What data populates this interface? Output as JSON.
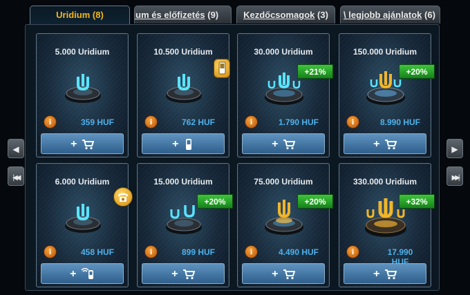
{
  "tabs": [
    {
      "label": "Uridium",
      "count": "(8)",
      "active": true
    },
    {
      "label": "mium és előfizetés",
      "count": "(9)",
      "active": false
    },
    {
      "label": "Kezdőcsomagok",
      "count": "(3)",
      "active": false
    },
    {
      "label": "\\ legjobb ajánlatok",
      "count": "(6)",
      "active": false
    }
  ],
  "nav": {
    "prev_icon": "arrow-left-icon",
    "first_icon": "skip-first-icon",
    "next_icon": "arrow-right-icon",
    "last_icon": "skip-last-icon"
  },
  "colors": {
    "accent_tab": "#f3b81c",
    "price": "#4fb1ec",
    "bonus": "#2ba62e",
    "buy_button": "#3f74a3"
  },
  "cards": [
    {
      "title": "5.000 Uridium",
      "price": "359 HUF",
      "bonus": "",
      "badge": "",
      "buy_icon": "cart-icon"
    },
    {
      "title": "10.500 Uridium",
      "price": "762 HUF",
      "bonus": "",
      "badge": "mobile-icon",
      "buy_icon": "mobile-phone-icon"
    },
    {
      "title": "30.000 Uridium",
      "price": "1.790 HUF",
      "bonus": "+21%",
      "badge": "",
      "buy_icon": "cart-icon"
    },
    {
      "title": "150.000 Uridium",
      "price": "8.990 HUF",
      "bonus": "+20%",
      "badge": "",
      "buy_icon": "cart-icon"
    },
    {
      "title": "6.000 Uridium",
      "price": "458 HUF",
      "bonus": "",
      "badge": "telephone-icon",
      "buy_icon": "phone-call-icon"
    },
    {
      "title": "15.000 Uridium",
      "price": "899 HUF",
      "bonus": "+20%",
      "badge": "",
      "buy_icon": "cart-icon"
    },
    {
      "title": "75.000 Uridium",
      "price": "4.490 HUF",
      "bonus": "+20%",
      "badge": "",
      "buy_icon": "cart-icon"
    },
    {
      "title": "330.000 Uridium",
      "price": "17.990 HUF",
      "bonus": "+32%",
      "badge": "",
      "buy_icon": "cart-icon"
    }
  ],
  "buy_label": "+",
  "info_label": "i"
}
